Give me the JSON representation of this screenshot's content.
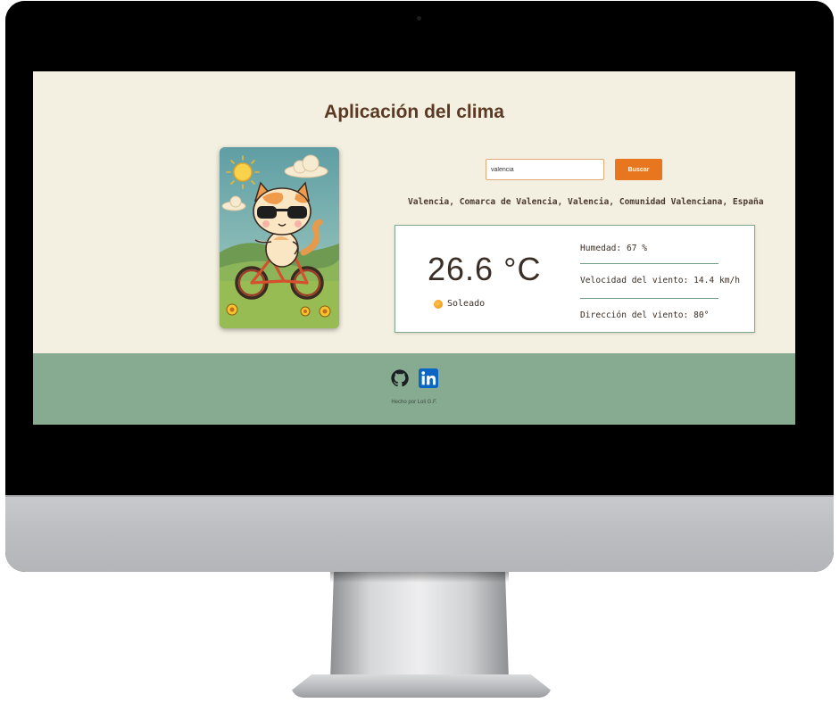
{
  "header": {
    "title": "Aplicación del clima"
  },
  "search": {
    "value": "valencia",
    "button_label": "Buscar"
  },
  "location": {
    "full_name": "Valencia, Comarca de Valencia, Valencia, Comunidad Valenciana, España"
  },
  "weather": {
    "temperature": "26.6 °C",
    "condition": "Soleado",
    "condition_icon": "sun-icon",
    "humidity": "Humedad: 67 %",
    "wind_speed": "Velocidad del viento: 14.4 km/h",
    "wind_direction": "Dirección del viento: 80°"
  },
  "footer": {
    "links": [
      {
        "icon": "github-icon"
      },
      {
        "icon": "linkedin-icon"
      }
    ],
    "credit": "Hecho por Loli G.F."
  },
  "colors": {
    "page_background": "#f4f0e1",
    "title": "#5a3a24",
    "accent": "#e8761f",
    "card_border": "#7faa8f",
    "footer_background": "#86ab91",
    "linkedin": "#0a66c2"
  }
}
